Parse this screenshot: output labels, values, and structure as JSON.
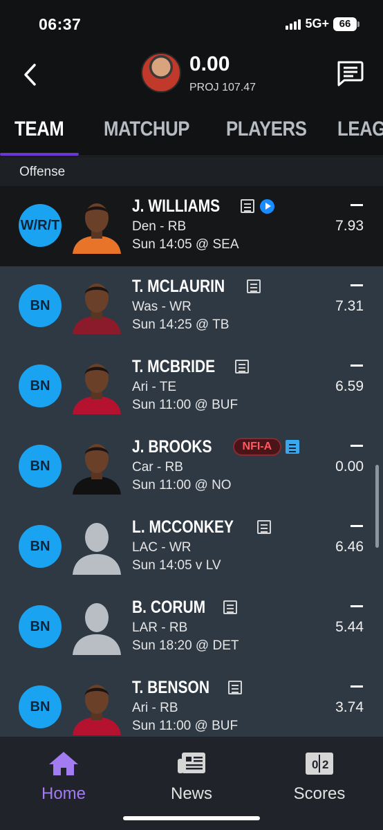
{
  "status_bar": {
    "time": "06:37",
    "network": "5G+",
    "battery": "66"
  },
  "header": {
    "score": "0.00",
    "projection": "PROJ 107.47"
  },
  "tabs": [
    {
      "label": "TEAM"
    },
    {
      "label": "MATCHUP"
    },
    {
      "label": "PLAYERS"
    },
    {
      "label": "LEAG"
    }
  ],
  "section": {
    "label": "Offense"
  },
  "players": [
    {
      "slot": "W/R/T",
      "name": "J. WILLIAMS",
      "team_pos": "Den - RB",
      "game": "Sun 14:05 @ SEA",
      "score": "—",
      "projection": "7.93",
      "starter": true,
      "has_video": true,
      "jersey_color": "#e8742a"
    },
    {
      "slot": "BN",
      "name": "T. MCLAURIN",
      "team_pos": "Was - WR",
      "game": "Sun 14:25 @ TB",
      "score": "—",
      "projection": "7.31",
      "jersey_color": "#8b1a2a"
    },
    {
      "slot": "BN",
      "name": "T. MCBRIDE",
      "team_pos": "Ari - TE",
      "game": "Sun 11:00 @ BUF",
      "score": "—",
      "projection": "6.59",
      "jersey_color": "#b5122f"
    },
    {
      "slot": "BN",
      "name": "J. BROOKS",
      "badge": "NFI-A",
      "team_pos": "Car - RB",
      "game": "Sun 11:00 @ NO",
      "score": "—",
      "projection": "0.00",
      "note_highlight": true,
      "jersey_color": "#111111"
    },
    {
      "slot": "BN",
      "name": "L. MCCONKEY",
      "team_pos": "LAC - WR",
      "game": "Sun 14:05 v LV",
      "score": "—",
      "projection": "6.46",
      "placeholder": true
    },
    {
      "slot": "BN",
      "name": "B. CORUM",
      "team_pos": "LAR - RB",
      "game": "Sun 18:20 @ DET",
      "score": "—",
      "projection": "5.44",
      "placeholder": true
    },
    {
      "slot": "BN",
      "name": "T. BENSON",
      "team_pos": "Ari - RB",
      "game": "Sun 11:00 @ BUF",
      "score": "—",
      "projection": "3.74",
      "jersey_color": "#b5122f"
    }
  ],
  "bottom_nav": [
    {
      "label": "Home",
      "icon": "home-icon"
    },
    {
      "label": "News",
      "icon": "news-icon"
    },
    {
      "label": "Scores",
      "icon": "scores-icon"
    }
  ],
  "colors": {
    "accent": "#6a36d6",
    "slot_badge": "#1aa3f0",
    "active_nav": "#a47cf2"
  }
}
